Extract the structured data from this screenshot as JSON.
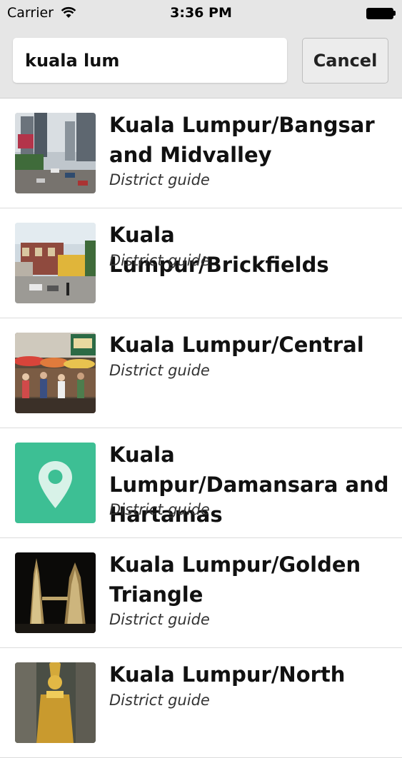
{
  "status_bar": {
    "carrier": "Carrier",
    "time": "3:36 PM"
  },
  "search": {
    "value": "kuala lum",
    "cancel_label": "Cancel"
  },
  "results": [
    {
      "title": "Kuala Lumpur/Bangsar and Midvalley",
      "subtitle": "District guide",
      "thumbnail": "city-street-photo"
    },
    {
      "title": "Kuala Lumpur/Brickfields",
      "subtitle": "District guide",
      "thumbnail": "shophouse-street-photo"
    },
    {
      "title": "Kuala Lumpur/Central",
      "subtitle": "District guide",
      "thumbnail": "market-umbrellas-photo"
    },
    {
      "title": "Kuala Lumpur/Damansara and Hartamas",
      "subtitle": "District guide",
      "thumbnail": "map-pin-placeholder"
    },
    {
      "title": "Kuala Lumpur/Golden Triangle",
      "subtitle": "District guide",
      "thumbnail": "petronas-towers-photo"
    },
    {
      "title": "Kuala Lumpur/North",
      "subtitle": "District guide",
      "thumbnail": "golden-statue-photo"
    }
  ],
  "colors": {
    "bar_background": "#e6e6e6",
    "pin_placeholder": "#3dbf94"
  }
}
